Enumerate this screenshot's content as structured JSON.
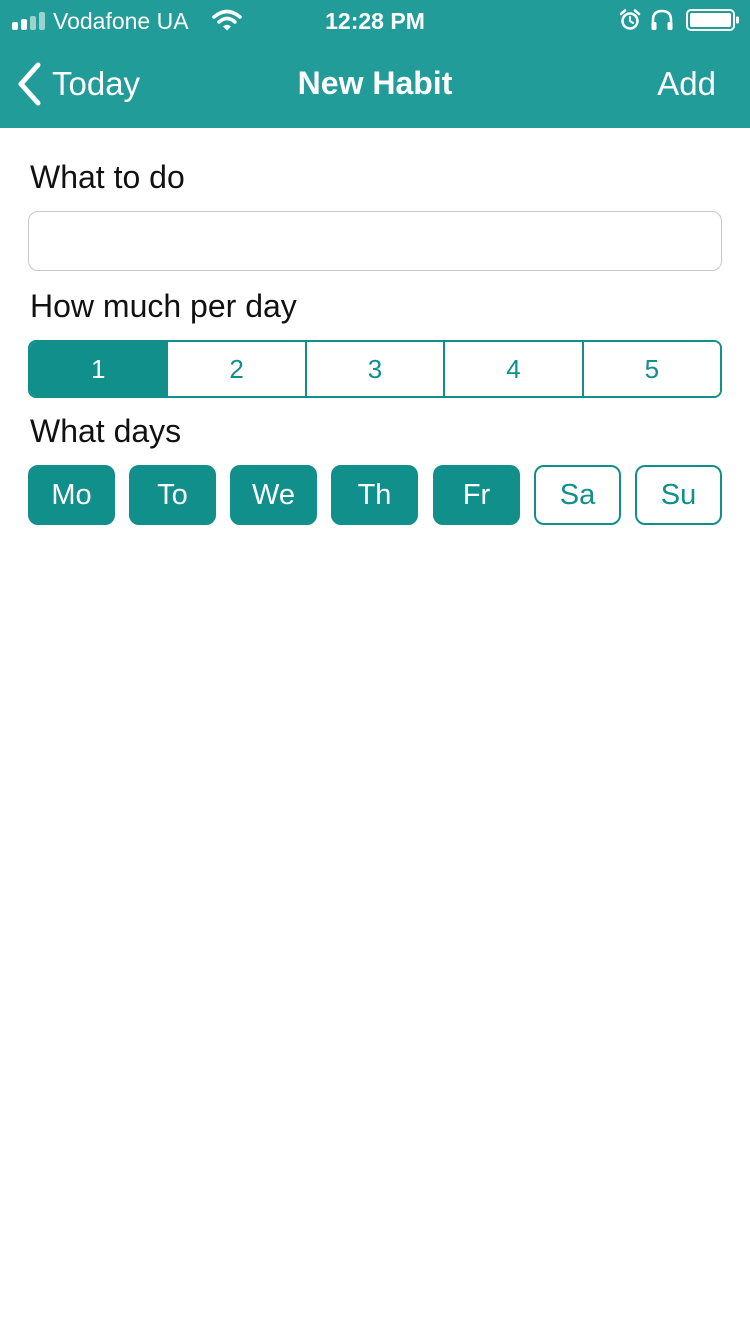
{
  "colors": {
    "header_bg": "#229c98",
    "accent": "#118f8b",
    "background": "#ffffff"
  },
  "status_bar": {
    "carrier": "Vodafone UA",
    "time": "12:28 PM",
    "icons": [
      "signal-icon",
      "wifi-icon",
      "alarm-icon",
      "headphones-icon",
      "battery-icon"
    ]
  },
  "nav": {
    "back_label": "Today",
    "title": "New Habit",
    "action_label": "Add"
  },
  "form": {
    "what_label": "What to do",
    "what_value": "",
    "how_much_label": "How much per day",
    "how_much_options": [
      "1",
      "2",
      "3",
      "4",
      "5"
    ],
    "how_much_selected": "1",
    "days_label": "What days",
    "days": [
      {
        "label": "Mo",
        "selected": true
      },
      {
        "label": "To",
        "selected": true
      },
      {
        "label": "We",
        "selected": true
      },
      {
        "label": "Th",
        "selected": true
      },
      {
        "label": "Fr",
        "selected": true
      },
      {
        "label": "Sa",
        "selected": false
      },
      {
        "label": "Su",
        "selected": false
      }
    ]
  }
}
